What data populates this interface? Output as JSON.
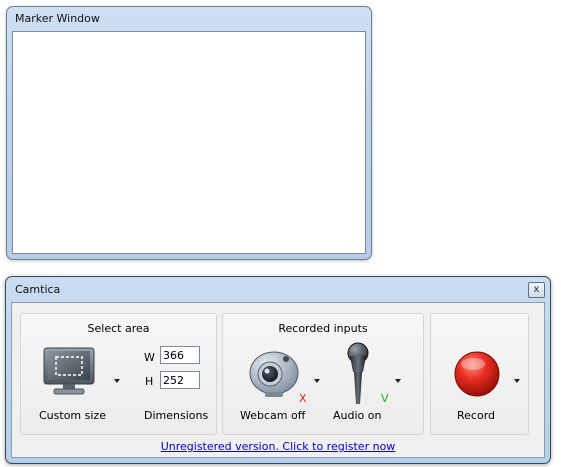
{
  "marker_window": {
    "title": "Marker Window"
  },
  "camtica": {
    "title": "Camtica",
    "close_glyph": "x",
    "select_area": {
      "title": "Select area",
      "custom_size_label": "Custom size",
      "dimensions_label": "Dimensions",
      "width_label": "W",
      "width_value": "366",
      "height_label": "H",
      "height_value": "252",
      "icon": "monitor-select-icon"
    },
    "recorded_inputs": {
      "title": "Recorded inputs",
      "webcam_label": "Webcam off",
      "webcam_status": "X",
      "audio_label": "Audio on",
      "audio_status": "V",
      "webcam_icon": "webcam-icon",
      "audio_icon": "microphone-icon"
    },
    "record": {
      "label": "Record",
      "icon": "record-icon"
    },
    "register_link": "Unregistered version. Click to register now"
  },
  "colors": {
    "record_red": "#e52b1e",
    "link_blue": "#0000cc",
    "status_off": "#e02020",
    "status_on": "#20b020"
  }
}
